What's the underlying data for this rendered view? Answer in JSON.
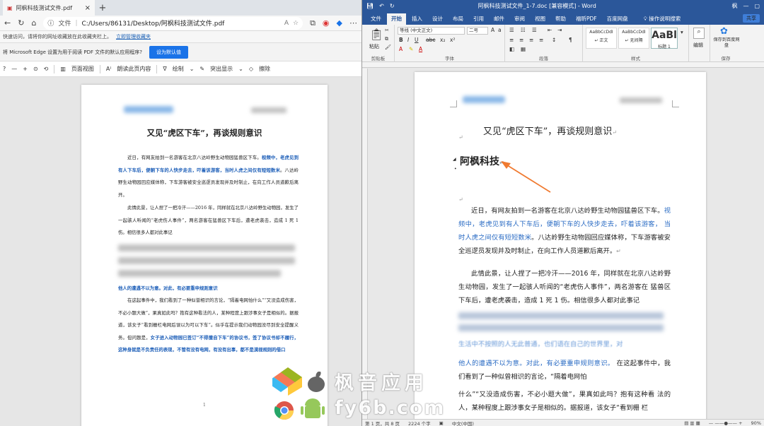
{
  "edge": {
    "tab_title": "阿枫科技测试文件.pdf",
    "address_label": "文件",
    "url": "C:/Users/86131/Desktop/阿枫科技测试文件.pdf",
    "fav_notice": "快速访问，请将你的网址收藏放在此收藏夹栏上。",
    "fav_link": "立即管理收藏夹",
    "info_text": "将 Microsoft Edge 设置为用于阅读 PDF 文件的默认应用程序?",
    "info_button": "设为默认值",
    "toolbar": {
      "page_view": "页面视图",
      "read_aloud": "朗读此页内容",
      "draw": "绘制",
      "highlight": "突出显示",
      "erase": "擦除"
    }
  },
  "pdf": {
    "title": "又见“虎区下车”，再谈规则意识",
    "p1_a": "近日，有网友拍到一名游客在北京八达岭野生动物园猛兽区下车。",
    "p1_b": "视频中，老虎见到有人下车后，便朝下车的人快步走去，吓着该游客，当时人虎之间仅有短短数米",
    "p1_c": "。八达岭野生动物园回应媒体称，下车游客被安全巡逻员发现并及时制止，在向工作人员道歉后离开。",
    "p2": "此情此景，让人捏了一把冷汗——2016 年，同样就在北京八达岭野生动物园，发生了一起骇人听闻的“老虎伤人事件”，两名游客在猛兽区下车后，遭老虎袭击，造成 1 死 1 伤。相信很多人都对此事记",
    "p3_b": "他人的遭遇不以为意。对此，有必要重申规则意识",
    "p3": "在这起事件中，我们看到了一种似曾相识的言论，“隔着电网怕什么”“又没造成伤害，不必小题大做”，果真如此吗？抱有这种看法的人，某种程度上跟涉事女子是相似的。据报道，该女子“看到栅栏电网后误以为可以下车”。似乎在提示我们动物园没尽到安全提醒义务。但问题是，",
    "p3_c": "女子进入动物园已签订“不得擅自下车”的协议书，签了协议书却不履行，这种身就是不负责任的表现，不管有没有电网，有没有出事，都不是漠视规则的借口",
    "page_num": "1"
  },
  "word": {
    "doc_title": "阿枫科技测试文件_1-7.doc [兼容模式] - Word",
    "user": "枫",
    "share": "共享",
    "tabs": [
      "文件",
      "开始",
      "插入",
      "设计",
      "布局",
      "引用",
      "邮件",
      "审阅",
      "视图",
      "帮助",
      "福昕PDF",
      "百度网盘"
    ],
    "search_tab": "操作说明搜索",
    "font_name": "等线 (中文正文)",
    "font_size": "二号",
    "groups": {
      "clipboard": "剪贴板",
      "font": "字体",
      "paragraph": "段落",
      "styles": "样式",
      "save": "保存"
    },
    "paste": "粘贴",
    "edit": "编辑",
    "save_baidu": "保存到百度网盘",
    "styles": [
      {
        "preview": "AaBbCcDdI",
        "name": "↵ 正文"
      },
      {
        "preview": "AaBbCcDdI",
        "name": "↵ 无间隔"
      },
      {
        "preview": "AaBl",
        "name": "标题 1"
      }
    ],
    "doc_heading": "又见“虎区下车”，再谈规则意识",
    "inserted_heading": "阿枫科技",
    "p1_a": "近日，有网友拍到一名游客在北京八达岭野生动物园猛兽区下车。",
    "p1_b": "视频中，老虎见到有人下车后，便朝下车的人快步走去，吓着该游客， 当时人虎之间仅有短短数米",
    "p1_c": "。八达岭野生动物园回应媒体称，下车游客被安全巡逻员发现并及时制止，在向工作人员道歉后离开。",
    "p2": "此情此景，让人捏了一把冷汗——2016 年，同样就在北京八达岭野生动物园，发生了一起骇人听闻的“老虎伤人事件”，两名游客在 猛兽区下车后，遭老虎袭击，造成 1 死 1 伤。相信很多人都对此事记",
    "p3_partial": "生活中不按照的人无此普通，也们语在自己的世界里，对",
    "p4_b": "他人的遭遇不以为意。对此，有必要重申规则意识。",
    "p4_a": " 在这起事件中，我们看到了一种似曾相识的言论，“隔着电网怕",
    "p5": "什么”“又没造成伤害，不必小题大做”，果真如此吗？抱有这种看 法的人，某种程度上跟涉事女子是相似的。据报道，该女子“看到栅 栏",
    "status": {
      "page": "第 1 页，共 8 页",
      "words": "2224 个字",
      "lang": "中文(中国)",
      "zoom": "90%"
    }
  },
  "watermark": {
    "line1": "枫音应用",
    "line2": "fy6b.com"
  },
  "colors": {
    "word_blue": "#2b579a",
    "pdf_blue": "#1c5eb8",
    "edge_btn": "#1a73e8",
    "arrow": "#f07a30"
  }
}
